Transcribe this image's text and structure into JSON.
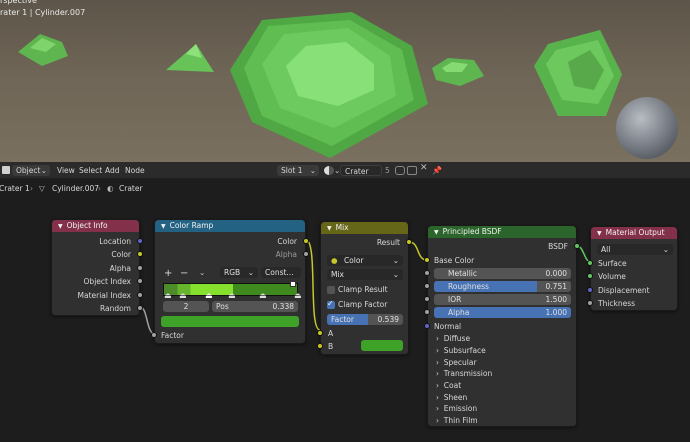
{
  "viewport": {
    "overlay_top": "rspective",
    "overlay_title": "rater 1 | Cylinder.007"
  },
  "header": {
    "mode": "Object",
    "menus": [
      "View",
      "Select",
      "Add",
      "Node"
    ],
    "slot": "Slot 1",
    "material": "Crater",
    "users": "5"
  },
  "breadcrumb": {
    "items": [
      "Crater 1",
      "Cylinder.007",
      "Crater"
    ]
  },
  "nodes": {
    "object_info": {
      "title": "Object Info",
      "outputs": [
        "Location",
        "Color",
        "Alpha",
        "Object Index",
        "Material Index",
        "Random"
      ]
    },
    "color_ramp": {
      "title": "Color Ramp",
      "outputs": [
        "Color",
        "Alpha"
      ],
      "add": "+",
      "remove": "−",
      "color_mode": "RGB",
      "interpolation": "Const...",
      "stop_index": "2",
      "pos_label": "Pos",
      "pos_value": "0.338",
      "input_factor": "Factor"
    },
    "mix": {
      "title": "Mix",
      "output": "Result",
      "data_type": "Color",
      "blend": "Mix",
      "clamp_result": "Clamp Result",
      "clamp_factor": "Clamp Factor",
      "factor_label": "Factor",
      "factor_value": "0.539",
      "input_a": "A",
      "input_b": "B"
    },
    "principled": {
      "title": "Principled BSDF",
      "output": "BSDF",
      "base_color": "Base Color",
      "fields": [
        {
          "label": "Metallic",
          "value": "0.000"
        },
        {
          "label": "Roughness",
          "value": "0.751"
        },
        {
          "label": "IOR",
          "value": "1.500"
        },
        {
          "label": "Alpha",
          "value": "1.000"
        }
      ],
      "normal": "Normal",
      "panels": [
        "Diffuse",
        "Subsurface",
        "Specular",
        "Transmission",
        "Coat",
        "Sheen",
        "Emission",
        "Thin Film"
      ]
    },
    "material_output": {
      "title": "Material Output",
      "target": "All",
      "inputs": [
        "Surface",
        "Volume",
        "Displacement",
        "Thickness"
      ]
    }
  },
  "colors": {
    "object_info_header": "#83314a",
    "color_ramp_header": "#246283",
    "mix_header": "#666619",
    "principled_header": "#2b652b",
    "material_output_header": "#83314a"
  }
}
